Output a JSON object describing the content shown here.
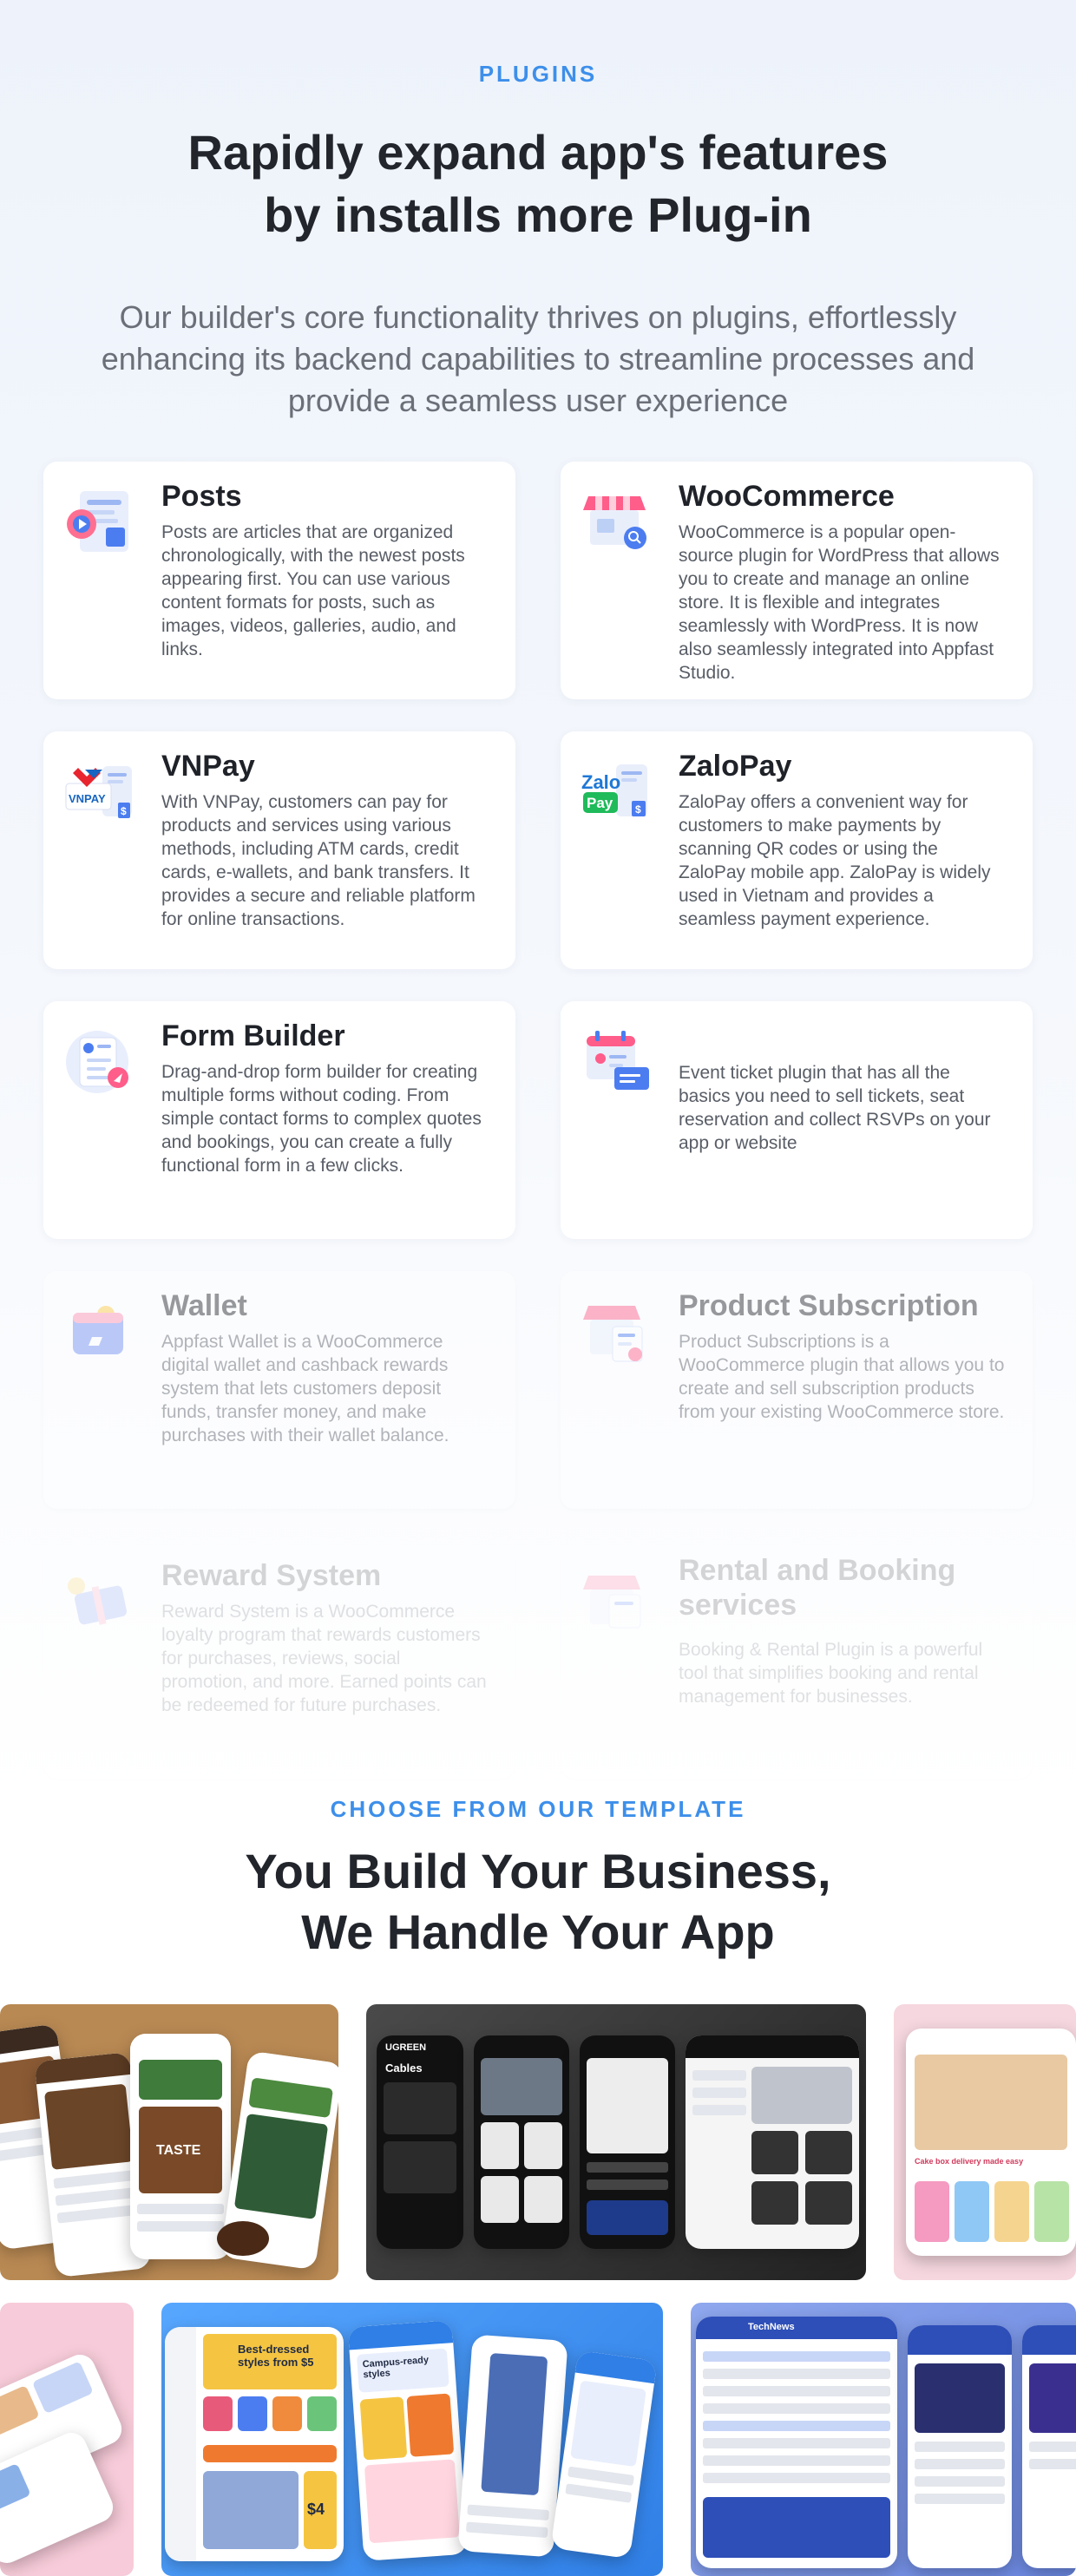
{
  "plugins_section": {
    "eyebrow": "PLUGINS",
    "title_line1": "Rapidly expand app's features",
    "title_line2": "by installs more Plug-in",
    "subtitle": "Our builder's core functionality thrives on plugins, effortlessly enhancing its backend capabilities to streamline processes and provide a seamless user experience",
    "cards": [
      {
        "title": "Posts",
        "icon": "posts-icon",
        "description": "Posts are articles that are organized chronologically, with the newest posts appearing first. You can use various content formats for posts, such as images, videos, galleries, audio, and links."
      },
      {
        "title": "WooCommerce",
        "icon": "store-icon",
        "description": "WooCommerce is a popular open-source plugin for WordPress that allows you to create and manage an online store. It is flexible and integrates seamlessly with WordPress. It is now also seamlessly integrated into Appfast Studio."
      },
      {
        "title": "VNPay",
        "icon": "vnpay-logo-icon",
        "description": "With VNPay, customers can pay for products and services using various methods, including ATM cards, credit cards, e-wallets, and bank transfers. It provides a secure and reliable platform for online transactions."
      },
      {
        "title": "ZaloPay",
        "icon": "zalopay-logo-icon",
        "description": "ZaloPay offers a convenient way for customers to make payments by scanning QR codes or using the ZaloPay mobile app. ZaloPay is widely used in Vietnam and provides a seamless payment experience."
      },
      {
        "title": "Form Builder",
        "icon": "form-icon",
        "description": "Drag-and-drop form builder for creating multiple forms without coding. From simple contact forms to complex quotes and bookings, you can create a fully functional form in a few clicks."
      },
      {
        "title": "",
        "icon": "calendar-ticket-icon",
        "description": "Event ticket plugin that has all the basics you need to sell tickets, seat reservation and collect RSVPs on your app or website"
      },
      {
        "title": "Wallet",
        "icon": "wallet-icon",
        "description": "Appfast Wallet is a WooCommerce digital wallet and cashback rewards system that lets customers deposit funds, transfer money, and make purchases with their wallet balance."
      },
      {
        "title": "Product Subscription",
        "icon": "subscription-store-icon",
        "description": "Product Subscriptions is a WooCommerce plugin that allows you to create and sell subscription products from your existing WooCommerce store."
      },
      {
        "title": "Reward System",
        "icon": "gift-card-icon",
        "description": "Reward System is a WooCommerce loyalty program that rewards customers for purchases, reviews, social promotion, and more. Earned points can be redeemed for future purchases."
      },
      {
        "title": "Rental and Booking services",
        "icon": "booking-store-icon",
        "description": "Booking & Rental Plugin is a powerful tool that simplifies booking and rental management for businesses."
      }
    ]
  },
  "templates_section": {
    "eyebrow": "CHOOSE FROM OUR TEMPLATE",
    "title_line1": "You Build Your Business,",
    "title_line2": "We Handle Your App",
    "previews": [
      {
        "name": "coffee-template",
        "label": "TASTE",
        "color": "#b98953"
      },
      {
        "name": "ugreen-template",
        "label": "UGREEN",
        "sublabel": "Cables",
        "color": "#3a3a3a"
      },
      {
        "name": "cake-template",
        "label": "Cake box delivery made easy",
        "color": "#f6d7df"
      },
      {
        "name": "pink-template",
        "color": "#f7cbd9"
      },
      {
        "name": "fashion-template",
        "label": "Best-dressed styles from $5",
        "label2": "Campus-ready styles",
        "price": "$4",
        "color": "#3a8ff0"
      },
      {
        "name": "technews-template",
        "label": "TechNews",
        "color": "#7b97e6"
      }
    ]
  },
  "colors": {
    "accent": "#3d8fea",
    "heading": "#22252b",
    "body": "#585d66"
  }
}
